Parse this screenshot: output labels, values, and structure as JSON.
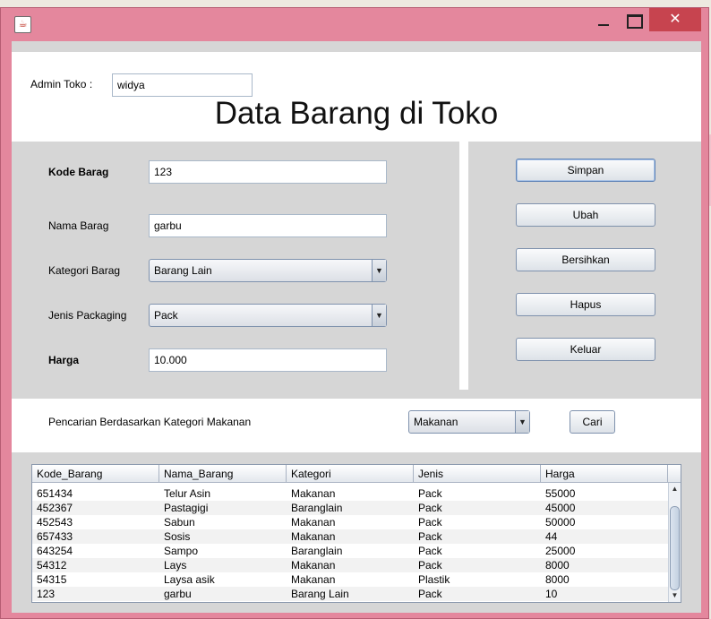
{
  "window": {
    "app_icon": "java-icon",
    "close_glyph": "✕"
  },
  "admin": {
    "label": "Admin Toko :",
    "value": "widya"
  },
  "page_title": "Data Barang di Toko",
  "form": {
    "kode": {
      "label": "Kode Barag",
      "value": "123"
    },
    "nama": {
      "label": "Nama Barag",
      "value": "garbu"
    },
    "kategori": {
      "label": "Kategori Barag",
      "value": "Barang Lain"
    },
    "jenis": {
      "label": "Jenis Packaging",
      "value": "Pack"
    },
    "harga": {
      "label": "Harga",
      "value": "10.000"
    }
  },
  "buttons": {
    "simpan": "Simpan",
    "ubah": "Ubah",
    "bersihkan": "Bersihkan",
    "hapus": "Hapus",
    "keluar": "Keluar"
  },
  "search": {
    "label": "Pencarian Berdasarkan Kategori Makanan",
    "selected": "Makanan",
    "button": "Cari"
  },
  "table": {
    "columns": [
      "Kode_Barang",
      "Nama_Barang",
      "Kategori",
      "Jenis",
      "Harga"
    ],
    "rows": [
      [
        "651434",
        "Telur Asin",
        "Makanan",
        "Pack",
        "55000"
      ],
      [
        "452367",
        "Pastagigi",
        "Baranglain",
        "Pack",
        "45000"
      ],
      [
        "452543",
        "Sabun",
        "Makanan",
        "Pack",
        "50000"
      ],
      [
        "657433",
        "Sosis",
        "Makanan",
        "Pack",
        "44"
      ],
      [
        "643254",
        "Sampo",
        "Baranglain",
        "Pack",
        "25000"
      ],
      [
        "54312",
        "Lays",
        "Makanan",
        "Pack",
        "8000"
      ],
      [
        "54315",
        "Laysa asik",
        "Makanan",
        "Plastik",
        "8000"
      ],
      [
        "123",
        "garbu",
        "Barang Lain",
        "Pack",
        "10"
      ]
    ]
  }
}
